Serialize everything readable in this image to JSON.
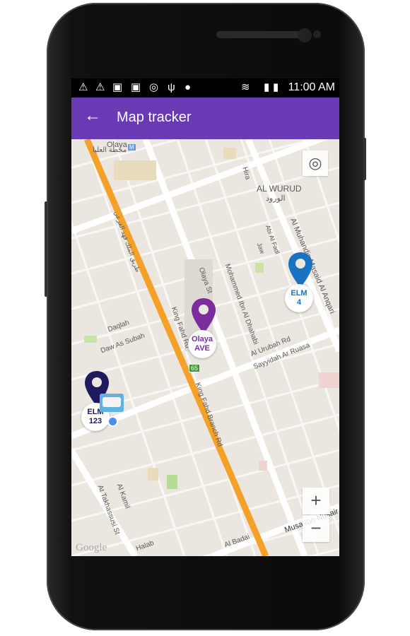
{
  "status_bar": {
    "icons": [
      "warning-icon",
      "warning-icon",
      "clipboard-check-icon",
      "media-icon",
      "gps-icon",
      "usb-icon",
      "android-icon",
      "wifi-icon",
      "sim-icon",
      "battery-charging-icon"
    ],
    "time": "11:00 AM"
  },
  "app_bar": {
    "title": "Map tracker",
    "back_icon": "arrow-left-icon",
    "color": "#6a3ab5"
  },
  "map": {
    "labels": {
      "olaya_station": "Olaya",
      "olaya_station_ar": "محطة العليا",
      "metro": "M",
      "hira": "Hira",
      "al_wurud": "AL WURUD",
      "al_wurud_ar": "الورود",
      "al_muhandis": "Al Muhandis Masaid Al Anqari",
      "abi_al_fadl": "Abi Al Fadl",
      "jaw": "Jaw",
      "king_fahd_ar": "طريق الملك فهد الفرعي",
      "olaya_st": "Olaya St",
      "mohammed": "Mohammed Ibn Al Dhahabi",
      "king_fahd": "King Fahd Rd",
      "daqlah": "Daqlah",
      "daw": "Daw As Subah",
      "al_urubah": "Al Urubah Rd",
      "sayyidah": "Sayyidah Ar Ruasa",
      "route": "65",
      "king_fahd_branch": "King Fahd Branch Rd",
      "takhassusi": "At Takhassusi St",
      "kamil": "Al Kamil",
      "halab": "Halab",
      "badai": "Al Badai",
      "musa": "Musa Ibn Nusair",
      "google": "Google"
    },
    "markers": [
      {
        "line1": "ELM",
        "line2": "4",
        "color": "#1a73c0"
      },
      {
        "line1": "Olaya",
        "line2": "AVE",
        "color": "#7b2d9e"
      },
      {
        "line1": "ELM",
        "line2": "123",
        "color": "#1f1a5e"
      }
    ],
    "controls": {
      "my_location": "my-location-icon",
      "zoom_in": "+",
      "zoom_out": "−"
    }
  }
}
